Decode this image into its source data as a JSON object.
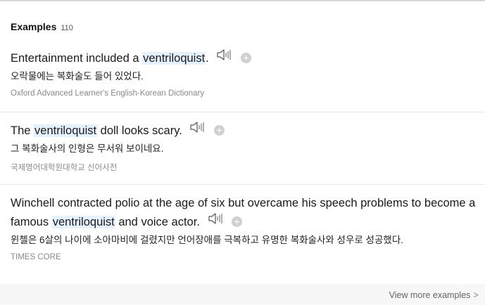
{
  "section": {
    "title": "Examples",
    "count": "110"
  },
  "examples": [
    {
      "en_before": "Entertainment included a ",
      "keyword": "ventriloquist",
      "en_after": ".",
      "ko": "오락물에는 복화술도 들어 있었다.",
      "source": "Oxford Advanced Learner's English-Korean Dictionary"
    },
    {
      "en_before": "The ",
      "keyword": "ventriloquist",
      "en_after": " doll looks scary.",
      "ko": "그 복화술사의 인형은 무서워 보이네요.",
      "source": "국제영어대학원대학교 신어사전"
    },
    {
      "en_before": "Winchell contracted polio at the age of six but overcame his speech problems to become a famous ",
      "keyword": "ventriloquist",
      "en_after": " and voice actor.",
      "ko": "윈첼은 6살의 나이에 소아마비에 걸렸지만 언어장애를 극복하고 유명한 복화술사와 성우로 성공했다.",
      "source": "TIMES CORE"
    }
  ],
  "footer": {
    "view_more_label": "View more examples",
    "chevron": ">"
  },
  "icons": {
    "speaker": "speaker-icon",
    "add": "plus-circle-icon"
  },
  "colors": {
    "highlight": "#e6f1ff",
    "divider": "#e6e6e6",
    "footer_bg": "#f7f7f7"
  }
}
